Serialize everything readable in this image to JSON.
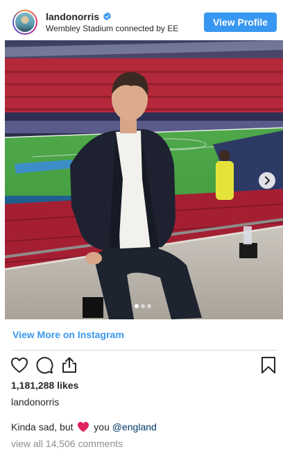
{
  "post": {
    "username": "landonorris",
    "verified": true,
    "location": "Wembley Stadium connected by EE",
    "view_profile_label": "View Profile",
    "photo_alt": "",
    "carousel": {
      "total": 3,
      "current": 1
    },
    "view_more_label": "View More on Instagram",
    "likes": "1,181,288 likes",
    "caption_username": "landonorris",
    "caption_before": "Kinda sad, but",
    "caption_middle": "you",
    "caption_mention": "@england",
    "view_comments": "view all 14,506 comments"
  },
  "icons": {
    "verified": "verified-badge-icon",
    "like": "heart-outline-icon",
    "comment": "comment-bubble-icon",
    "share": "share-upload-icon",
    "save": "bookmark-icon",
    "next": "chevron-right-icon",
    "caption_emoji": "red-heart-emoji"
  },
  "colors": {
    "accent": "#3897f0",
    "text": "#262626",
    "muted": "#8e8e8e",
    "mention": "#00376b",
    "divider": "#dbdbdb"
  }
}
